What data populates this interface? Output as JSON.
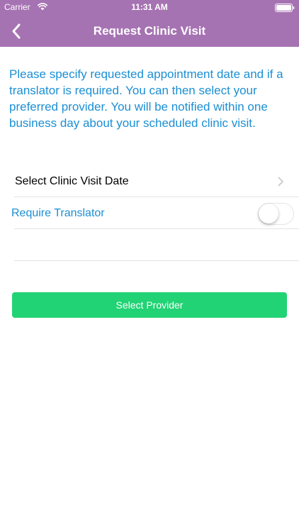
{
  "status_bar": {
    "carrier": "Carrier",
    "time": "11:31 AM"
  },
  "nav": {
    "title": "Request Clinic Visit",
    "back_icon": "chevron-left-icon"
  },
  "intro_text": "Please specify requested appointment date and if a translator is required. You can then select your preferred provider. You will be notified within one business day about your scheduled clinic visit.",
  "rows": {
    "date_label": "Select Clinic Visit Date",
    "translator_label": "Require Translator",
    "translator_enabled": false
  },
  "actions": {
    "select_provider_label": "Select Provider"
  },
  "colors": {
    "header": "#a673b2",
    "accent_blue": "#1b8fd3",
    "button_green": "#21d374"
  }
}
